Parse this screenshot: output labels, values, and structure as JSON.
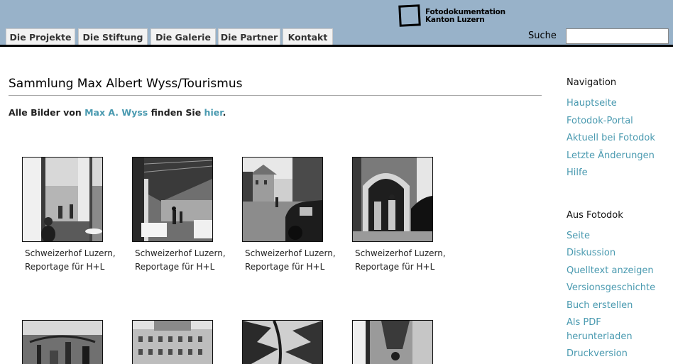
{
  "header": {
    "logo_line1": "Fotodokumentation",
    "logo_line2": "Kanton Luzern",
    "tabs": [
      "Die Projekte",
      "Die Stiftung",
      "Die Galerie",
      "Die Partner",
      "Kontakt"
    ],
    "search_label": "Suche",
    "search_value": ""
  },
  "main": {
    "title": "Sammlung Max Albert Wyss/Tourismus",
    "intro_before": "Alle Bilder von ",
    "intro_link1": "Max A. Wyss",
    "intro_middle": " finden Sie ",
    "intro_link2": "hier",
    "intro_after": ".",
    "gallery": [
      {
        "line1": "Schweizerhof Luzern,",
        "line2": "Reportage für H+L"
      },
      {
        "line1": "Schweizerhof Luzern,",
        "line2": "Reportage für H+L"
      },
      {
        "line1": "Schweizerhof Luzern,",
        "line2": "Reportage für H+L"
      },
      {
        "line1": "Schweizerhof Luzern,",
        "line2": "Reportage für H+L"
      }
    ]
  },
  "sidebar": {
    "nav_heading": "Navigation",
    "nav_links": [
      "Hauptseite",
      "Fotodok-Portal",
      "Aktuell bei Fotodok",
      "Letzte Änderungen",
      "Hilfe"
    ],
    "tools_heading": "Aus Fotodok",
    "tools_links": [
      "Seite",
      "Diskussion",
      "Quelltext anzeigen",
      "Versionsgeschichte",
      "Buch erstellen",
      "Als PDF",
      "herunterladen",
      "Druckversion"
    ]
  },
  "colors": {
    "header_bg": "#98b2c9",
    "link": "#4a9ab0"
  }
}
